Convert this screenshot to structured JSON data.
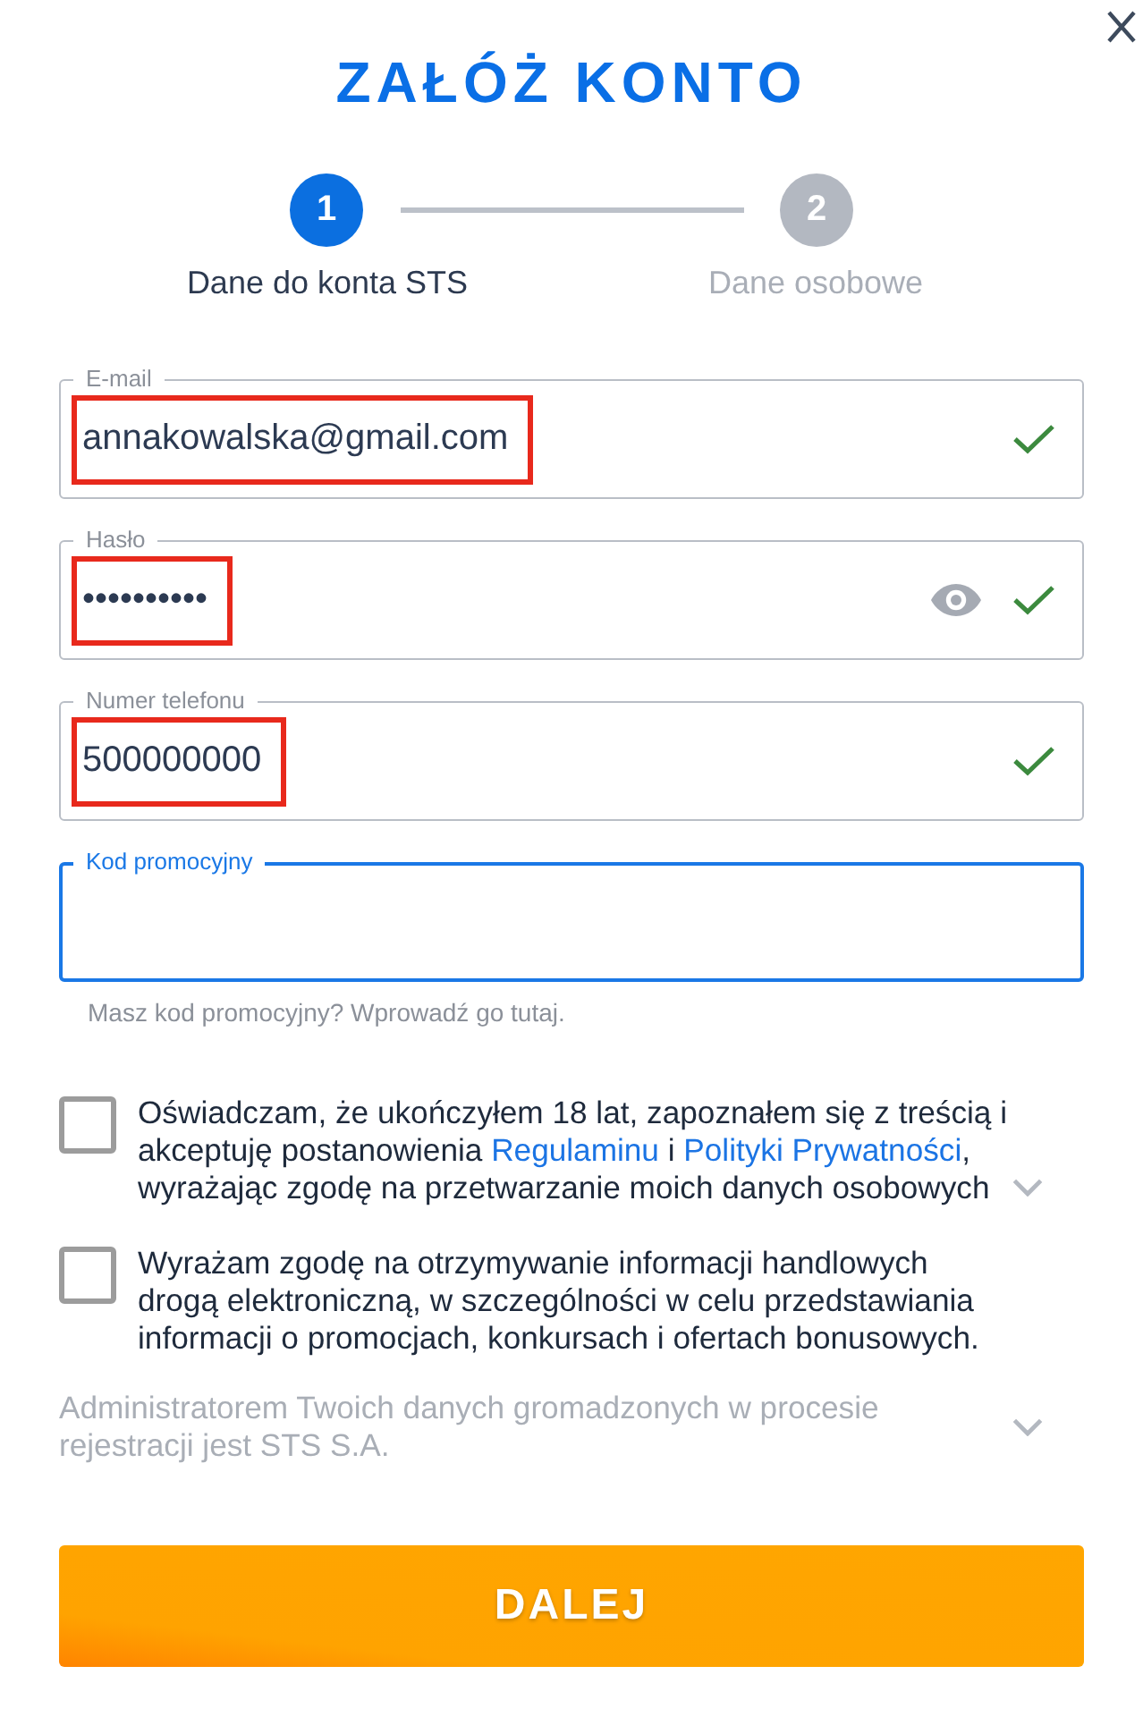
{
  "title": "ZAŁÓŻ KONTO",
  "steps": [
    {
      "number": "1",
      "label": "Dane do konta STS",
      "selected": true
    },
    {
      "number": "2",
      "label": "Dane osobowe",
      "selected": false
    }
  ],
  "fields": [
    {
      "kind": "email",
      "label": "E-mail",
      "value": "annakowalska@gmail.com",
      "valid": true,
      "focused": false,
      "highlighted": true
    },
    {
      "kind": "password",
      "label": "Hasło",
      "value": "••••••••••",
      "valid": true,
      "focused": false,
      "highlighted": true
    },
    {
      "kind": "phone",
      "label": "Numer telefonu",
      "value": "500000000",
      "valid": true,
      "focused": false,
      "highlighted": true
    },
    {
      "kind": "promo",
      "label": "Kod promocyjny",
      "valid": false,
      "focused": true,
      "highlighted": false,
      "hint": "Masz kod promocyjny? Wprowadź go tutaj."
    }
  ],
  "consents": [
    {
      "checked": false,
      "expandable": true,
      "parts": [
        {
          "kind": "text",
          "text": "Oświadczam, że ukończyłem 18 lat, zapoznałem się z treścią i akceptuję postanowienia "
        },
        {
          "kind": "link",
          "text": "Regulaminu"
        },
        {
          "kind": "text",
          "text": " i "
        },
        {
          "kind": "link",
          "text": "Polityki Prywatności"
        },
        {
          "kind": "text",
          "text": ", wyrażając zgodę na przetwarzanie moich danych osobowych"
        }
      ]
    },
    {
      "checked": false,
      "expandable": false,
      "parts": [
        {
          "kind": "text",
          "text": "Wyrażam zgodę na otrzymywanie informacji handlowych drogą elektroniczną, w szczególności w celu przedstawiania informacji o promocjach, konkursach i ofertach bonusowych."
        }
      ]
    }
  ],
  "notice": {
    "text": "Administratorem Twoich danych gromadzonych w procesie rejestracji jest STS S.A.",
    "expandable": true
  },
  "submit_button": {
    "label": "DALEJ"
  }
}
